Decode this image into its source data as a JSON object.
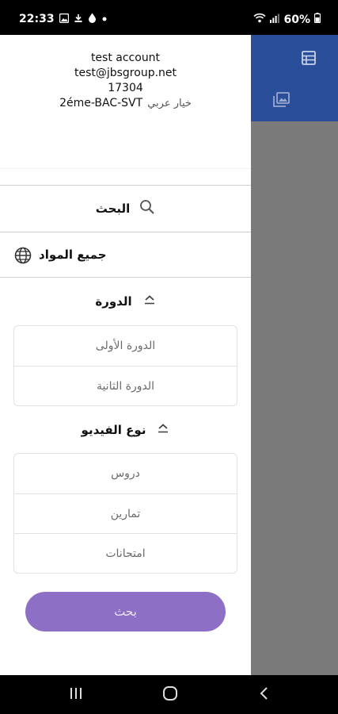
{
  "status_bar": {
    "time": "22:33",
    "notification_icons": [
      "image-icon",
      "download-icon",
      "droplet-icon",
      "dot-icon"
    ],
    "battery": "60%"
  },
  "app_header": {
    "icons": [
      "table-icon",
      "gallery-icon"
    ],
    "color": "#2a4e9a"
  },
  "drawer": {
    "profile": {
      "name": "test account",
      "email": "test@jbsgroup.net",
      "id": "17304",
      "level": "2éme-BAC-SVT",
      "option": "خيار عربي"
    },
    "search_row": {
      "label": "البحث"
    },
    "all_subjects_row": {
      "label": "جميع المواد"
    },
    "session_section": {
      "title": "الدورة",
      "items": [
        "الدورة الأولى",
        "الدورة الثانية"
      ]
    },
    "video_type_section": {
      "title": "نوع الفيديو",
      "items": [
        "دروس",
        "تمارين",
        "امتحانات"
      ]
    },
    "search_button": {
      "label": "بحث",
      "color": "#8e6fc6"
    }
  },
  "nav_bar": {
    "buttons": [
      "recents-button",
      "home-button",
      "back-button"
    ]
  }
}
